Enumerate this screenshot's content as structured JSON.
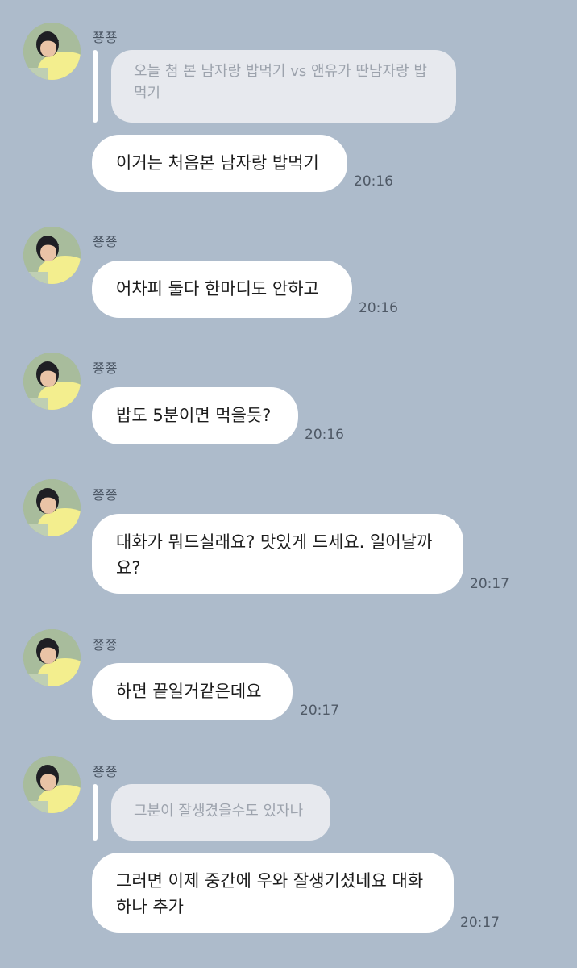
{
  "messages": [
    {
      "sender": "쭁쭁",
      "quote": "오늘 첨 본 남자랑 밥먹기 vs 앤유가 딴남자랑 밥먹기",
      "text": "이거는 처음본 남자랑 밥먹기",
      "time": "20:16"
    },
    {
      "sender": "쭁쭁",
      "text": "어차피 둘다 한마디도 안하고",
      "time": "20:16"
    },
    {
      "sender": "쭁쭁",
      "text": "밥도 5분이면 먹을듯?",
      "time": "20:16"
    },
    {
      "sender": "쭁쭁",
      "text": "대화가 뭐드실래요? 맛있게 드세요. 일어날까요?",
      "time": "20:17"
    },
    {
      "sender": "쭁쭁",
      "text": "하면 끝일거같은데요",
      "time": "20:17"
    },
    {
      "sender": "쭁쭁",
      "quote": "그분이 잘생겼을수도 있자나",
      "text": "그러면 이제 중간에 우와 잘생기셨네요 대화 하나 추가",
      "time": "20:17"
    }
  ],
  "avatar_icon": "profile-photo",
  "colors": {
    "background": "#adbbcb",
    "bubble": "#ffffff",
    "quote_bubble": "#e7e9ee",
    "reply_bar": "#ffffff"
  }
}
